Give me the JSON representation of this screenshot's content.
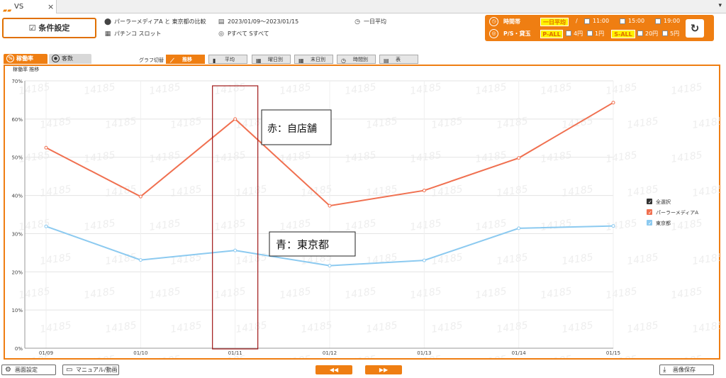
{
  "tab": {
    "logo": "▰▰",
    "title": "VS",
    "close": "×",
    "menu": "▾"
  },
  "toolbar": {
    "condition_button": "条件設定",
    "comparison": "パーラーメディアA と 東京都の比較",
    "machine_type": "パチンコ スロット",
    "date_range": "2023/01/09～2023/01/15",
    "p_s_filter": "Pすべて Sすべて",
    "average_mode": "一日平均"
  },
  "filter": {
    "time_label": "時間帯",
    "time_selected": "一日平均",
    "separator": "/",
    "times": [
      "11:00",
      "15:00",
      "19:00"
    ],
    "rate_label": "P/S・貸玉",
    "p_all": "P-ALL",
    "p_rates": [
      "4円",
      "1円"
    ],
    "s_all": "S-ALL",
    "s_rates": [
      "20円",
      "5円"
    ],
    "refresh_icon": "refresh-icon"
  },
  "side_tabs": [
    "稼働率",
    "客数"
  ],
  "graph_switch": {
    "label": "グラフ切替",
    "buttons": [
      "推移",
      "平均",
      "曜日別",
      "末日別",
      "時間別",
      "表"
    ],
    "active": "推移"
  },
  "chart_data": {
    "type": "line",
    "title": "稼働率 推移",
    "categories": [
      "01/09",
      "01/10",
      "01/11",
      "01/12",
      "01/13",
      "01/14",
      "01/15"
    ],
    "ylim": [
      0,
      70
    ],
    "yticks": [
      "0%",
      "10%",
      "20%",
      "30%",
      "40%",
      "50%",
      "60%",
      "70%"
    ],
    "grid": true,
    "legend_position": "right",
    "watermark": "14185",
    "series": [
      {
        "name": "パーラーメディアA",
        "color": "#f07050",
        "values": [
          52.5,
          39.7,
          60.0,
          37.3,
          41.3,
          49.8,
          64.3
        ]
      },
      {
        "name": "東京都",
        "color": "#8ccaf0",
        "values": [
          31.9,
          23.1,
          25.6,
          21.6,
          23.0,
          31.4,
          32.0
        ]
      }
    ],
    "legend": [
      "全選択",
      "パーラーメディアA",
      "東京都"
    ],
    "annotations": [
      {
        "text": "赤：自店舗"
      },
      {
        "text": "青：東京都"
      }
    ]
  },
  "bottom": {
    "screen_settings": "画面設定",
    "manual": "マニュアル/動画",
    "prev": "◀◀",
    "next": "▶▶",
    "save_image": "画像保存"
  }
}
